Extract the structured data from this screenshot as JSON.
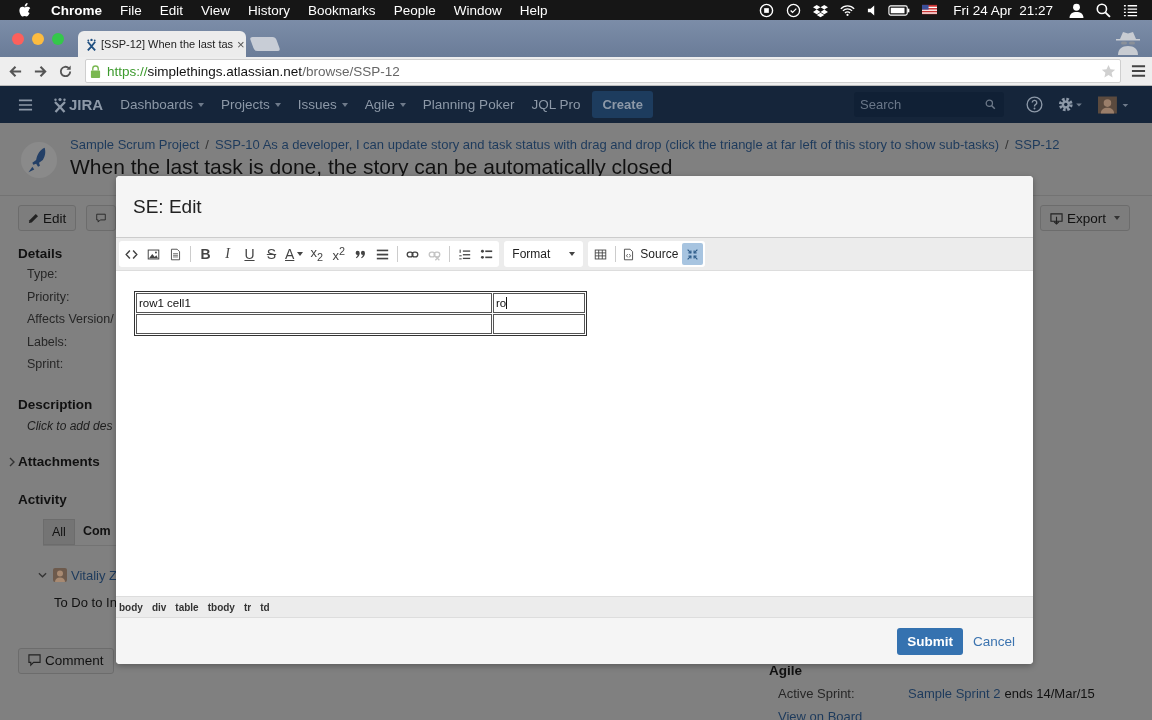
{
  "menubar": {
    "app": "Chrome",
    "menus": [
      "File",
      "Edit",
      "View",
      "History",
      "Bookmarks",
      "People",
      "Window",
      "Help"
    ],
    "clock": "Fri 24 Apr  21:27"
  },
  "browser": {
    "tab_title": "[SSP-12] When the last tas",
    "tab_close": "×",
    "url": {
      "scheme": "https://",
      "host": "simplethings.atlassian.net",
      "path": "/browse/SSP-12"
    }
  },
  "nav": {
    "logo": "JIRA",
    "items": [
      {
        "label": "Dashboards",
        "dropdown": true
      },
      {
        "label": "Projects",
        "dropdown": true
      },
      {
        "label": "Issues",
        "dropdown": true
      },
      {
        "label": "Agile",
        "dropdown": true
      },
      {
        "label": "Planning Poker",
        "dropdown": false
      },
      {
        "label": "JQL Pro",
        "dropdown": false
      }
    ],
    "create": "Create",
    "search_placeholder": "Search"
  },
  "issue": {
    "breadcrumb": [
      "Sample Scrum Project",
      "SSP-10 As a developer, I can update story and task status with drag and drop (click the triangle at far left of this story to show sub-tasks)",
      "SSP-12"
    ],
    "separator": "/",
    "title": "When the last task is done, the story can be automatically closed",
    "edit": "Edit",
    "export": "Export"
  },
  "details": {
    "heading": "Details",
    "fields": [
      "Type:",
      "Priority:",
      "Affects Version/",
      "Labels:",
      "Sprint:"
    ]
  },
  "description": {
    "heading": "Description",
    "placeholder": "Click to add des"
  },
  "attachments": {
    "heading": "Attachments",
    "expanded": false
  },
  "activity": {
    "heading": "Activity",
    "tabs": [
      {
        "label": "All",
        "selected": true
      },
      {
        "label": "Com",
        "selected": false
      }
    ],
    "comment": {
      "author": "Vitaliy Z",
      "expanded": true,
      "text": "To Do to In"
    },
    "comment_button": "Comment"
  },
  "agile": {
    "heading": "Agile",
    "sprint_label": "Active Sprint:",
    "sprint_link": "Sample Sprint 2",
    "sprint_end": "ends 14/Mar/15",
    "board_link": "View on Board"
  },
  "dialog": {
    "title": "SE: Edit",
    "toolbar": [
      {
        "sections": [
          {
            "items": [
              {
                "kind": "code",
                "active": false,
                "disabled": false
              },
              {
                "kind": "image",
                "active": false,
                "disabled": false
              },
              {
                "kind": "template",
                "active": false,
                "disabled": false
              }
            ]
          },
          {
            "items": [
              {
                "kind": "bold",
                "label": "B",
                "active": false,
                "disabled": false
              },
              {
                "kind": "italic",
                "label": "I",
                "active": false,
                "disabled": false
              },
              {
                "kind": "underline",
                "label": "U",
                "active": false,
                "disabled": false
              },
              {
                "kind": "strike",
                "label": "S",
                "active": false,
                "disabled": false
              },
              {
                "kind": "color",
                "label": "A",
                "active": false,
                "disabled": false
              },
              {
                "kind": "sub",
                "label": "x$_{2}$",
                "active": false,
                "disabled": false
              },
              {
                "kind": "sup",
                "label": "x$^{2}$",
                "active": false,
                "disabled": false
              },
              {
                "kind": "quote",
                "active": false,
                "disabled": false
              },
              {
                "kind": "rule",
                "active": false,
                "disabled": false
              }
            ]
          },
          {
            "items": [
              {
                "kind": "link",
                "active": false,
                "disabled": false
              },
              {
                "kind": "unlink",
                "active": false,
                "disabled": true
              }
            ]
          },
          {
            "items": [
              {
                "kind": "ol",
                "active": false,
                "disabled": false
              },
              {
                "kind": "ul",
                "active": false,
                "disabled": false
              }
            ]
          }
        ]
      },
      {
        "sections": [
          {
            "items": [
              {
                "kind": "dropdown",
                "label": "Format",
                "active": false,
                "disabled": false
              }
            ]
          }
        ]
      },
      {
        "sections": [
          {
            "items": [
              {
                "kind": "table",
                "active": false,
                "disabled": false
              }
            ]
          },
          {
            "items": [
              {
                "kind": "source",
                "label": "Source",
                "active": false,
                "disabled": false
              },
              {
                "kind": "maximize",
                "active": true,
                "disabled": false
              }
            ]
          }
        ]
      }
    ],
    "rows": [
      {
        "cells": [
          {
            "text": "row1 cell1",
            "cursor": false
          },
          {
            "text": "ro",
            "cursor": true
          }
        ]
      },
      {
        "cells": [
          {
            "cursor": false
          },
          {
            "cursor": false
          }
        ]
      }
    ],
    "path": [
      "body",
      "div",
      "table",
      "tbody",
      "tr",
      "td"
    ],
    "submit": "Submit",
    "cancel": "Cancel"
  }
}
